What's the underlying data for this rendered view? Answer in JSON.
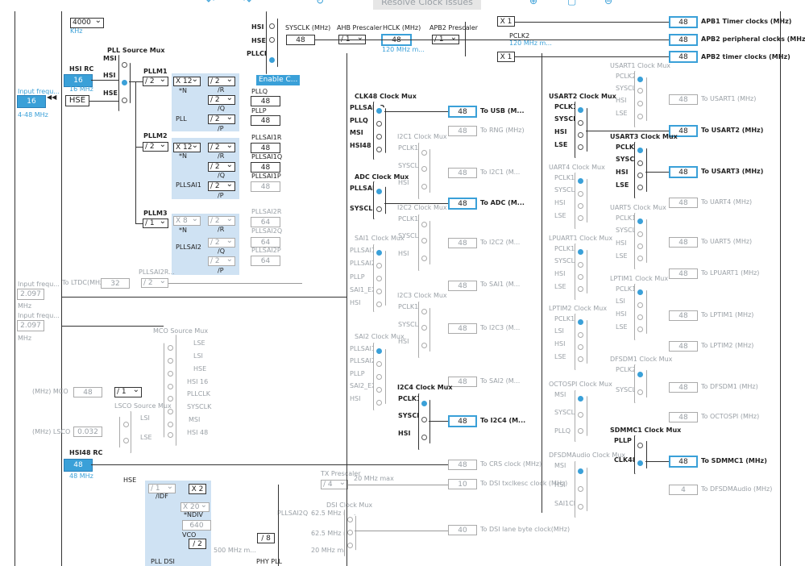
{
  "toolbar": {
    "resolve_label": "Resolve Clock Issues"
  },
  "left": {
    "khz_value": "4000",
    "khz_unit": "KHz",
    "hsi_rc_label": "HSI RC",
    "hsi_rc_value": "16",
    "hsi_rc_unit": "16 MHz",
    "input_freq_label": "Input frequ...",
    "input_freq_value": "16",
    "input_freq_range": "4-48 MHz",
    "hse_label": "HSE",
    "input_freq2_label": "Input frequ...",
    "input_freq2_value": "2.097",
    "input_freq2_unit": "MHz",
    "input_freq3_label": "Input frequ...",
    "input_freq3_value": "2.097",
    "input_freq3_unit": "MHz",
    "mco_label": "(MHz) MCO",
    "mco_value": "48",
    "mco_div": "/ 1",
    "lsco_label": "(MHz) LSCO",
    "lsco_value": "0.032",
    "hsi48_label": "HSI48 RC",
    "hsi48_value": "48",
    "hsi48_unit": "48 MHz"
  },
  "pll": {
    "source_mux_label": "PLL Source Mux",
    "msi": "MSI",
    "hsi": "HSI",
    "hse": "HSE",
    "pllm1": "PLLM1",
    "pllm1_div": "/ 2",
    "pllm2": "PLLM2",
    "pllm2_div": "/ 2",
    "pllm3": "PLLM3",
    "pllm3_div": "/ 1",
    "pll_label": "PLL",
    "pllsai1_label": "PLLSAI1",
    "pllsai2_label": "PLLSAI2",
    "n1": "X 12",
    "n2": "X 12",
    "n3": "X 8",
    "n_label": "*N",
    "r_label": "/R",
    "q_label": "/Q",
    "p_label": "/P",
    "div2": "/ 2",
    "pll_r_out": "PLLQ",
    "pllq_value": "48",
    "pllp_label": "PLLP",
    "pllp_value": "48",
    "pllsai1r_label": "PLLSAI1R",
    "pllsai1r_value": "48",
    "pllsai1q_label": "PLLSAI1Q",
    "pllsai1q_value": "48",
    "pllsai1p_label": "PLLSAI1P",
    "pllsai1p_value": "48",
    "pllsai2r_label": "PLLSAI2R",
    "pllsai2r_value": "64",
    "pllsai2q_label": "PLLSAI2Q",
    "pllsai2q_value": "64",
    "pllsai2p_label": "PLLSAI2P",
    "pllsai2p_value": "64",
    "pllsai2r_lower": "PLLSAI2R...",
    "ltdc_label": "To LTDC(MHz)",
    "ltdc_value": "32",
    "ltdc_div": "/ 2"
  },
  "sysclk": {
    "hsi": "HSI",
    "hse": "HSE",
    "pllclk": "PLLCLK",
    "label": "SYSCLK (MHz)",
    "value": "48",
    "enable_btn": "Enable C...",
    "ahb_label": "AHB Prescaler",
    "ahb_div": "/ 1",
    "hclk_label": "HCLK (MHz)",
    "hclk_value": "48",
    "hclk_max": "120 MHz m...",
    "apb2_label": "APB2 Prescaler",
    "apb2_div": "/ 1",
    "pclk2_label": "PCLK2",
    "pclk2_max": "120 MHz m...",
    "x1a": "X 1",
    "x1b": "X 1"
  },
  "apb_outputs": [
    {
      "value": "48",
      "label": "APB1 Timer clocks (MHz)"
    },
    {
      "value": "48",
      "label": "APB2 peripheral clocks (MHz)"
    },
    {
      "value": "48",
      "label": "APB2 timer clocks (MHz)"
    }
  ],
  "clk48": {
    "mux_label": "CLK48 Clock Mux",
    "inputs": [
      "PLLSAI1Q",
      "PLLQ",
      "MSI",
      "HSI48"
    ],
    "usb_value": "48",
    "usb_label": "To USB (M...",
    "rng_value": "48",
    "rng_label": "To RNG (MHz)"
  },
  "adc": {
    "mux_label": "ADC Clock Mux",
    "inputs": [
      "PLLSAI1R",
      "SYSCLK"
    ],
    "value": "48",
    "label": "To ADC (M..."
  },
  "i2c1": {
    "mux_label": "I2C1 Clock Mux",
    "inputs": [
      "PCLK1",
      "SYSCLK",
      "HSI"
    ],
    "value": "48",
    "label": "To I2C1 (M..."
  },
  "i2c2": {
    "mux_label": "I2C2 Clock Mux",
    "inputs": [
      "PCLK1",
      "SYSCLK",
      "HSI"
    ],
    "value": "48",
    "label": "To I2C2 (M..."
  },
  "i2c3": {
    "mux_label": "I2C3 Clock Mux",
    "inputs": [
      "PCLK1",
      "SYSCLK",
      "HSI"
    ],
    "value": "48",
    "label": "To I2C3 (M..."
  },
  "i2c4": {
    "mux_label": "I2C4 Clock Mux",
    "inputs": [
      "PCLK1",
      "SYSCLK",
      "HSI"
    ],
    "value": "48",
    "label": "To I2C4 (M..."
  },
  "sai1": {
    "mux_label": "SAI1 Clock Mux",
    "inputs": [
      "PLLSAI1P",
      "PLLSAI2P",
      "PLLP",
      "SAI1_EXT",
      "HSI"
    ],
    "value": "48",
    "label": "To SAI1 (M..."
  },
  "sai2": {
    "mux_label": "SAI2 Clock Mux",
    "inputs": [
      "PLLSAI1P",
      "PLLSAI2P",
      "PLLP",
      "SAI2_EXT",
      "HSI"
    ],
    "value": "48",
    "label": "To SAI2 (M..."
  },
  "crs": {
    "value": "48",
    "label": "To CRS clock (MHz)"
  },
  "dsi_txclk": {
    "prescaler_label": "TX Prescaler",
    "div": "/ 4",
    "max": "20 MHz max",
    "value": "10",
    "label": "To DSI txclkesc clock (MHz)"
  },
  "dsi_mux": {
    "label": "DSI Clock Mux",
    "pllsai2q": "PLLSAI2Q",
    "pllsai2q_max": "62.5 MHz m...",
    "max2": "62.5 MHz m...",
    "max3": "20 MHz max",
    "value": "40",
    "out_label": "To DSI lane byte clock(MHz)"
  },
  "dsi_pll": {
    "hse": "HSE",
    "idf_div": "/ 1",
    "idf_label": "/IDF",
    "x2": "X 2",
    "ndiv": "X 20",
    "ndiv_label": "*NDIV",
    "vco_value": "640",
    "vco_label": "VCO",
    "vco_div": "/ 2",
    "max500": "500 MHz m...",
    "div8": "/ 8",
    "bottom_label": "PLL DSI",
    "bottom_label2": "PHY PLL"
  },
  "mco_mux": {
    "label": "MCO Source Mux",
    "inputs": [
      "LSE",
      "LSI",
      "HSE",
      "HSI 16",
      "PLLCLK",
      "SYSCLK",
      "MSI",
      "HSI 48"
    ]
  },
  "lsco_mux": {
    "label": "LSCO Source Mux",
    "inputs": [
      "LSI",
      "LSE"
    ]
  },
  "usart1": {
    "mux_label": "USART1 Clock Mux",
    "inputs": [
      "PCLK2",
      "SYSCLK",
      "HSI",
      "LSE"
    ],
    "value": "48",
    "label": "To USART1 (MHz)"
  },
  "usart2": {
    "mux_label": "USART2 Clock Mux",
    "inputs": [
      "PCLK1",
      "SYSCLK",
      "HSI",
      "LSE"
    ],
    "value": "48",
    "label": "To USART2 (MHz)"
  },
  "usart3": {
    "mux_label": "USART3 Clock Mux",
    "inputs": [
      "PCLK1",
      "SYSCLK",
      "HSI",
      "LSE"
    ],
    "value": "48",
    "label": "To USART3 (MHz)"
  },
  "uart4": {
    "mux_label": "UART4 Clock Mux",
    "inputs": [
      "PCLK1",
      "SYSCLK",
      "HSI",
      "LSE"
    ],
    "value": "48",
    "label": "To UART4 (MHz)"
  },
  "uart5": {
    "mux_label": "UART5 Clock Mux",
    "inputs": [
      "PCLK1",
      "SYSCLK",
      "HSI",
      "LSE"
    ],
    "value": "48",
    "label": "To UART5 (MHz)"
  },
  "lpuart1": {
    "mux_label": "LPUART1 Clock Mux",
    "inputs": [
      "PCLK1",
      "SYSCLK",
      "HSI",
      "LSE"
    ],
    "value": "48",
    "label": "To LPUART1 (MHz)"
  },
  "lptim1": {
    "mux_label": "LPTIM1 Clock Mux",
    "inputs": [
      "PCLK1",
      "LSI",
      "HSI",
      "LSE"
    ],
    "value": "48",
    "label": "To LPTIM1 (MHz)"
  },
  "lptim2": {
    "mux_label": "LPTIM2 Clock Mux",
    "inputs": [
      "PCLK1",
      "LSI",
      "HSI",
      "LSE"
    ],
    "value": "48",
    "label": "To LPTIM2 (MHz)"
  },
  "dfsdm1": {
    "mux_label": "DFSDM1 Clock Mux",
    "inputs": [
      "PCLK2",
      "SYSCLK"
    ],
    "value": "48",
    "label": "To DFSDM1 (MHz)"
  },
  "octospi": {
    "mux_label": "OCTOSPI Clock Mux",
    "inputs": [
      "MSI",
      "SYSCLK",
      "PLLQ"
    ],
    "value": "48",
    "label": "To OCTOSPI (MHz)"
  },
  "sdmmc1": {
    "mux_label": "SDMMC1 Clock Mux",
    "inputs": [
      "PLLP",
      "CLK48"
    ],
    "value": "48",
    "label": "To SDMMC1 (MHz)"
  },
  "dfsdmaudio": {
    "mux_label": "DFSDMAudio Clock Mux",
    "inputs": [
      "MSI",
      "HSI",
      "SAI1CLK"
    ],
    "value": "4",
    "label": "To DFSDMAudio (MHz)"
  }
}
